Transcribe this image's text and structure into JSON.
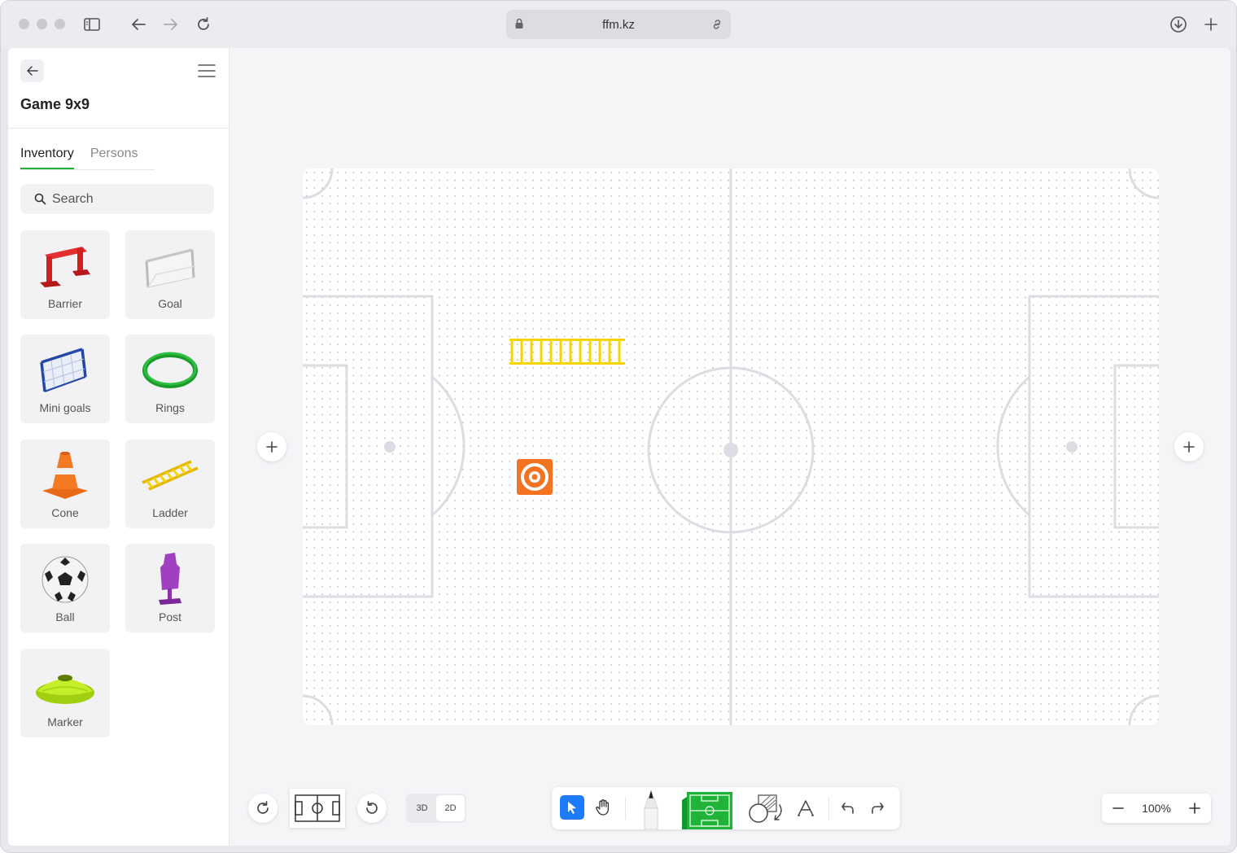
{
  "browser": {
    "url": "ffm.kz"
  },
  "sidebar": {
    "title": "Game 9x9",
    "tabs": [
      {
        "label": "Inventory",
        "active": true
      },
      {
        "label": "Persons",
        "active": false
      }
    ],
    "search": {
      "placeholder": "Search",
      "value": ""
    },
    "items": [
      {
        "label": "Barrier",
        "icon": "barrier-icon"
      },
      {
        "label": "Goal",
        "icon": "goal-icon"
      },
      {
        "label": "Mini goals",
        "icon": "mini-goals-icon"
      },
      {
        "label": "Rings",
        "icon": "rings-icon"
      },
      {
        "label": "Cone",
        "icon": "cone-icon"
      },
      {
        "label": "Ladder",
        "icon": "ladder-icon"
      },
      {
        "label": "Ball",
        "icon": "ball-icon"
      },
      {
        "label": "Post",
        "icon": "post-icon"
      },
      {
        "label": "Marker",
        "icon": "marker-icon"
      }
    ]
  },
  "field": {
    "placed_items": [
      "ladder",
      "marker-target"
    ]
  },
  "toolbar": {
    "view_modes": [
      {
        "label": "3D",
        "active": false
      },
      {
        "label": "2D",
        "active": true
      }
    ],
    "zoom": "100%",
    "active_tool": "select"
  },
  "colors": {
    "accent_green": "#1fb33a",
    "select_blue": "#1e7bff",
    "ladder_yellow": "#f5d400",
    "marker_orange": "#f37321"
  }
}
